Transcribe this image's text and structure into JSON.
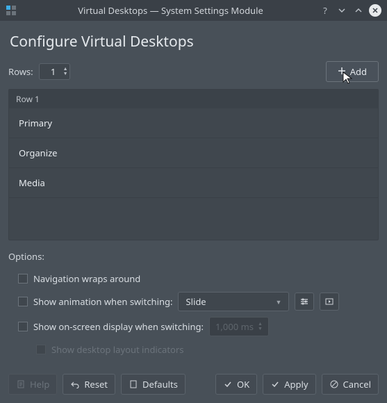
{
  "titlebar": {
    "title": "Virtual Desktops — System Settings Module"
  },
  "page": {
    "heading": "Configure Virtual Desktops"
  },
  "rows": {
    "label": "Rows:",
    "value": "1"
  },
  "add_button": {
    "label": "Add"
  },
  "list": {
    "header": "Row 1",
    "items": [
      "Primary",
      "Organize",
      "Media"
    ]
  },
  "options": {
    "label": "Options:",
    "nav_wrap": "Navigation wraps around",
    "show_anim": "Show animation when switching:",
    "anim_select": "Slide",
    "show_osd": "Show on-screen display when switching:",
    "osd_duration": "1,000 ms",
    "show_layout": "Show desktop layout indicators"
  },
  "footer": {
    "help": "Help",
    "reset": "Reset",
    "defaults": "Defaults",
    "ok": "OK",
    "apply": "Apply",
    "cancel": "Cancel"
  }
}
